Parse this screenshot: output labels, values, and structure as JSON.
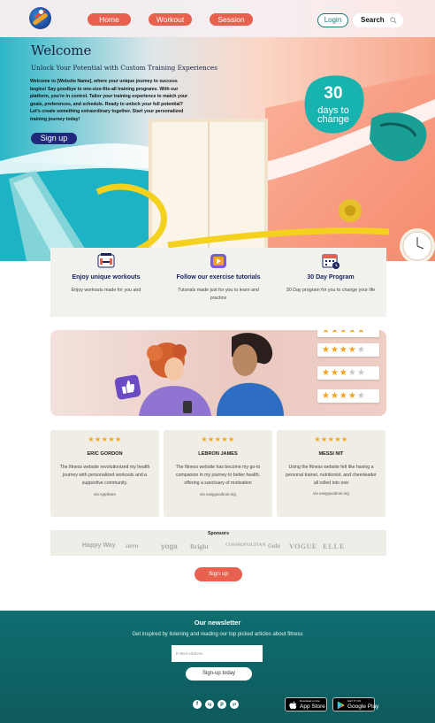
{
  "colors": {
    "accent": "#e8614e",
    "primary_dark": "#1f2a7a",
    "teal": "#17b3ae",
    "newsletter_bg": "#0e6e70",
    "star": "#f2a21b"
  },
  "header": {
    "logo_icon": "swoosh-logo-icon",
    "nav": [
      "Home",
      "Workout",
      "Session"
    ],
    "login_label": "Login",
    "search_label": "Search",
    "search_icon": "search-icon"
  },
  "hero": {
    "title": "Welcome",
    "subtitle": "Unlock Your Potential with Custom Training Experiences",
    "body": "Welcome to [Website Name], where your unique journey to success begins! Say goodbye to one-size-fits-all training programs. With our platform, you're in control. Tailor your training experience to match your goals, preferences, and schedule. Ready to unlock your full potential? Let's create something extraordinary together. Start your personalized training journey today!",
    "signup_label": "Sign up",
    "badge_number": "30",
    "badge_label": "days to change"
  },
  "features": [
    {
      "icon": "dumbbell-icon",
      "title": "Enjoy unique workouts",
      "desc": "Enjoy workouts made for you and"
    },
    {
      "icon": "video-play-icon",
      "title": "Follow our exercise tutorials",
      "desc": "Tutorials made just for you to learn and practice"
    },
    {
      "icon": "calendar-icon",
      "title": "30 Day Program",
      "desc": "30 Day program for you to change your life"
    }
  ],
  "banner": {
    "ratings": [
      5,
      4,
      3,
      4
    ],
    "like_icon": "thumbs-up-icon"
  },
  "testimonials": [
    {
      "stars": "★★★★★",
      "name": "ERIC GORDON",
      "quote": "The fitness website revolutionized my health journey with personalized workouts and a supportive community.",
      "source": "via AppStore"
    },
    {
      "stars": "★★★★★",
      "name": "LEBRON JAMES",
      "quote": "The fitness website has become my go-to companion in my journey to better health, offering a sanctuary of motivation",
      "source": "via easygoodmet.org"
    },
    {
      "stars": "★★★★★",
      "name": "MESSI NIT",
      "quote": "Using the fitness website felt like having a personal trainer, nutritionist, and cheerleader all rolled into one",
      "source": "via easygoodmet.org"
    }
  ],
  "sponsors": {
    "title": "Sponsors",
    "names": [
      "Happy Way",
      "stern",
      "yoga",
      "Bright",
      "COSMOPOLITAN",
      "Gala",
      "VOGUE",
      "ELLE"
    ]
  },
  "signup_mid_label": "Sign up",
  "newsletter": {
    "title": "Our newsletter",
    "subtitle": "Get inspired by listening and reading our top picked articles about fitness",
    "email_placeholder": "E-Mail Address",
    "signup_label": "Sign-up today",
    "social": [
      "f",
      "ig",
      "p",
      "yt"
    ],
    "appstore_small": "Download on the",
    "appstore_big": "App Store",
    "googleplay_small": "GET IT ON",
    "googleplay_big": "Google Play"
  }
}
